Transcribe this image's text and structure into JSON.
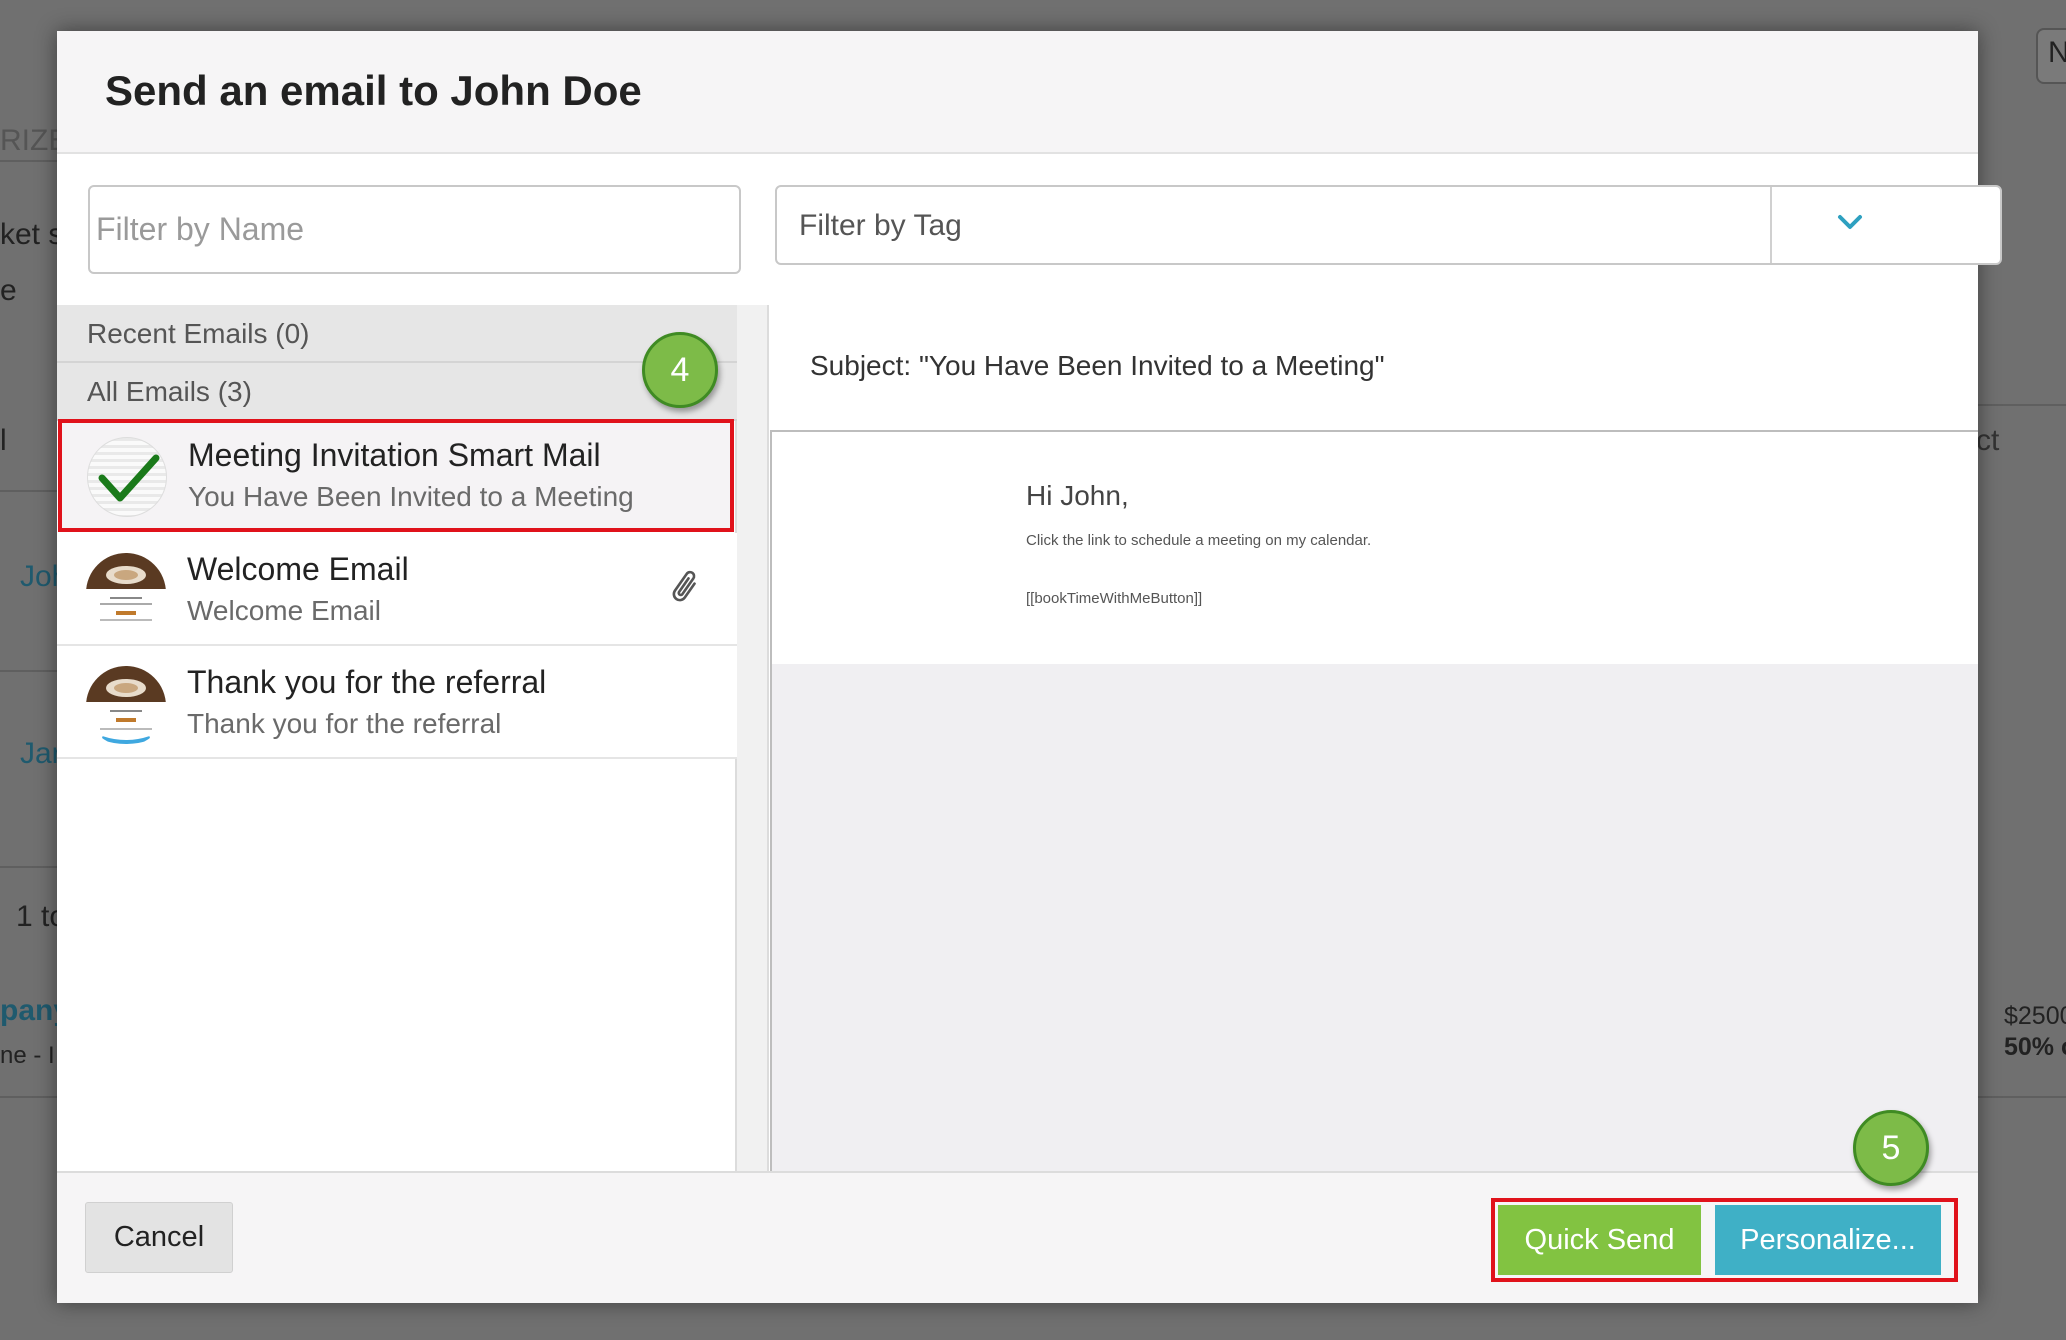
{
  "background": {
    "top_button": "N",
    "category_fragment": "RIZE",
    "market_fragment": "ket se",
    "e_fragment": "e",
    "l_fragment": "l",
    "row1_name": "Joh",
    "row2_name": "Jar",
    "pagination": "1 to",
    "company_link": "pany",
    "company_sub": "ne - I",
    "ct_fragment": "ct",
    "price": "$2500",
    "discount": "50% c"
  },
  "modal": {
    "title": "Send an email to John Doe",
    "filter_name_placeholder": "Filter by Name",
    "filter_tag_label": "Filter by Tag",
    "recent_emails": "Recent Emails (0)",
    "all_emails": "All Emails (3)",
    "emails": [
      {
        "title": "Meeting Invitation Smart Mail",
        "subtitle": "You Have Been Invited to a Meeting",
        "selected": true,
        "thumb": "check-icon"
      },
      {
        "title": "Welcome Email",
        "subtitle": "Welcome Email",
        "attachment": true,
        "thumb": "coffee-thumbnail"
      },
      {
        "title": "Thank you for the referral",
        "subtitle": "Thank you for the referral",
        "thumb": "coffee-thumbnail"
      }
    ],
    "subject": "Subject: \"You Have Been Invited to a Meeting\"",
    "preview": {
      "greeting": "Hi John,",
      "body": "Click the link to schedule a meeting on my calendar.",
      "placeholder": "[[bookTimeWithMeButton]]"
    },
    "footer": {
      "cancel": "Cancel",
      "quick_send": "Quick Send",
      "personalize": "Personalize..."
    }
  },
  "badges": {
    "step4": "4",
    "step5": "5"
  },
  "colors": {
    "quick_send": "#82c341",
    "personalize": "#3fb0c6",
    "highlight": "#e0121b",
    "badge": "#7dbb48",
    "chevron": "#2ea0c0"
  }
}
